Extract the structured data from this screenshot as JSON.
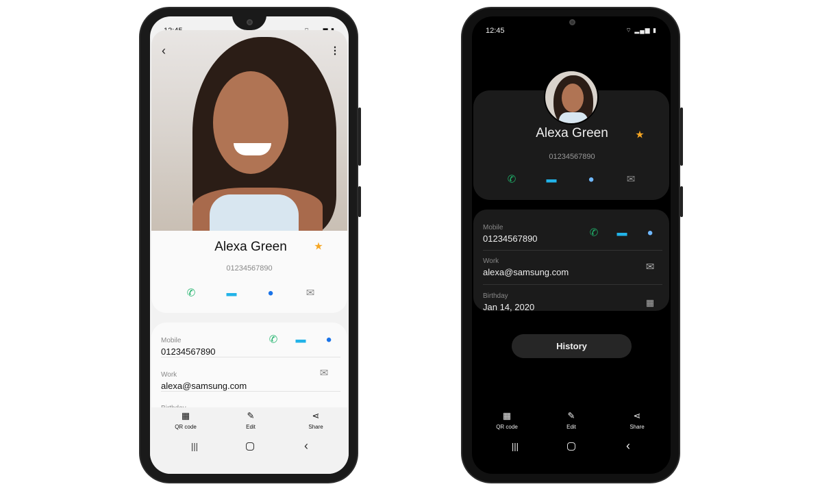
{
  "status": {
    "time": "12:45",
    "icons": "wifi signal battery"
  },
  "contact": {
    "name": "Alexa Green",
    "number": "01234567890",
    "favorite": true
  },
  "details": [
    {
      "label": "Mobile",
      "value": "01234567890"
    },
    {
      "label": "Work",
      "value": "alexa@samsung.com"
    },
    {
      "label": "Birthday",
      "value": "Jan 14, 2020"
    }
  ],
  "history_label": "History",
  "bottom_bar": {
    "qr": "QR code",
    "edit": "Edit",
    "share": "Share"
  },
  "colors": {
    "call": "#1fb36b",
    "message": "#22b3e8",
    "video": "#1a73e8",
    "video_dark": "#6fb8ff",
    "star": "#f6a623",
    "mail": "#8a8a8a"
  }
}
